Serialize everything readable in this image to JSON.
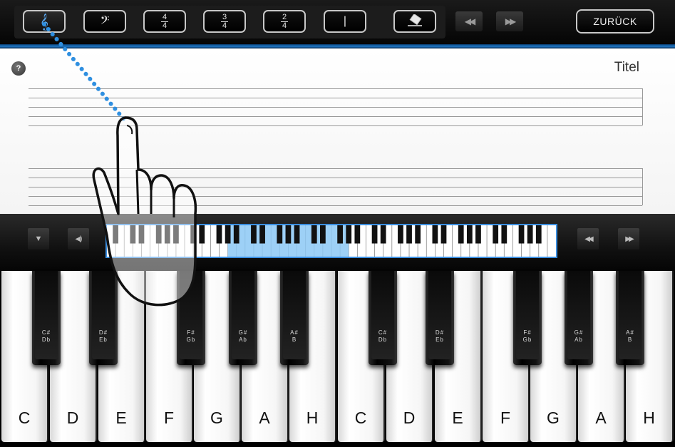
{
  "toolbar": {
    "treble_clef_glyph": "𝄞",
    "bass_clef_glyph": "𝄢",
    "time_signatures": [
      {
        "top": "4",
        "bottom": "4"
      },
      {
        "top": "3",
        "bottom": "4"
      },
      {
        "top": "2",
        "bottom": "4"
      }
    ],
    "barline_glyph": "|",
    "eraser_icon": "eraser-icon",
    "rewind_glyph": "◀◀",
    "forward_glyph": "▶▶",
    "back_label": "ZURÜCK"
  },
  "sheet": {
    "help_glyph": "?",
    "title": "Titel"
  },
  "controls": {
    "collapse_glyph": "▼",
    "sound_glyph": "◀)",
    "rewind_glyph": "◀◀",
    "forward_glyph": "▶▶",
    "overview_white_keys": 52,
    "visible_range_start_key": 14,
    "visible_range_count": 14,
    "highlight_color": "#8cc8f5"
  },
  "piano": {
    "white_keys": [
      "C",
      "D",
      "E",
      "F",
      "G",
      "A",
      "H",
      "C",
      "D",
      "E",
      "F",
      "G",
      "A",
      "H"
    ],
    "black_keys": [
      {
        "line1": "C#",
        "line2": "Db"
      },
      {
        "line1": "D#",
        "line2": "Eb"
      },
      {
        "line1": "F#",
        "line2": "Gb"
      },
      {
        "line1": "G#",
        "line2": "Ab"
      },
      {
        "line1": "A#",
        "line2": "B"
      },
      {
        "line1": "C#",
        "line2": "Db"
      },
      {
        "line1": "D#",
        "line2": "Eb"
      },
      {
        "line1": "F#",
        "line2": "Gb"
      },
      {
        "line1": "G#",
        "line2": "Ab"
      },
      {
        "line1": "A#",
        "line2": "B"
      }
    ]
  },
  "colors": {
    "accent": "#1e78c8",
    "gesture_dots": "#2f8fe0"
  },
  "gesture": {
    "icon": "pointing-hand-icon"
  }
}
